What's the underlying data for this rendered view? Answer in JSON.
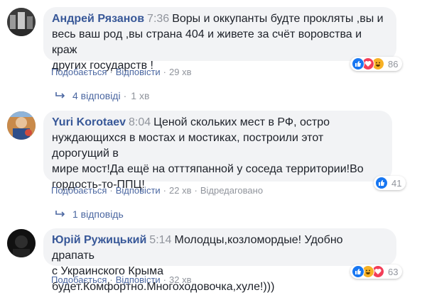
{
  "comments": [
    {
      "author": "Андрей Рязанов",
      "time": "7:36",
      "text_lines": [
        "Воры и оккупанты будте прокляты ,вы и",
        "весь ваш род ,вы страна 404 и живете за счёт воровства и краж",
        "других государств !"
      ],
      "actions": {
        "like": "Подобається",
        "reply": "Відповісти",
        "ago": "29 хв",
        "edited": ""
      },
      "reactions": {
        "types": [
          "like-icon",
          "love-icon",
          "haha-icon"
        ],
        "count": "86"
      },
      "replies": {
        "label": "4 відповіді",
        "time": "1 хв"
      }
    },
    {
      "author": "Yuri Korotaev",
      "time": "8:04",
      "text_lines": [
        "Ценой скольких мест в РФ, остро",
        "нуждающихся в мостах и мостиках, построили этот дорогущий в",
        "мире мост!Да ещё на отттяпанной у соседа территории!Во",
        "гордость-то-ППЦ!"
      ],
      "actions": {
        "like": "Подобається",
        "reply": "Відповісти",
        "ago": "22 хв",
        "edited": "Відредаговано"
      },
      "reactions": {
        "types": [
          "like-icon"
        ],
        "count": "41"
      },
      "replies": {
        "label": "1 відповідь",
        "time": ""
      }
    },
    {
      "author": "Юрій Ружицький",
      "time": "5:14",
      "text_lines": [
        "Молодцы,козломордые! Удобно драпать",
        "с Украинского Крыма будет.Комфортно.Многоходовочка,хуле!)))"
      ],
      "actions": {
        "like": "Подобається",
        "reply": "Відповісти",
        "ago": "32 хв",
        "edited": ""
      },
      "reactions": {
        "types": [
          "like-icon",
          "haha-icon",
          "love-icon"
        ],
        "count": "63"
      },
      "replies": {
        "label": "",
        "time": ""
      }
    }
  ],
  "colors": {
    "author": "#385898",
    "link": "#4b67a1",
    "meta": "#90949c",
    "bubble": "#f2f3f5",
    "like": "#1877f2",
    "love": "#f33e58",
    "haha": "#f7b125"
  }
}
